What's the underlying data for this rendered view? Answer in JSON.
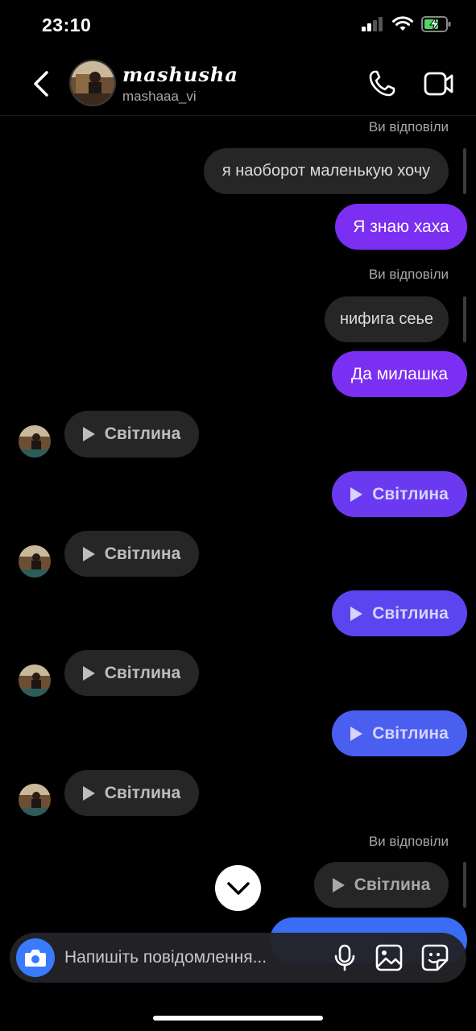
{
  "status": {
    "time": "23:10"
  },
  "header": {
    "title": "mashusha",
    "username": "mashaaa_vi"
  },
  "messages": [
    {
      "reply_label": "Ви відповіли",
      "quoted": "я наоборот маленькую хочу",
      "text": "Я знаю хаха"
    },
    {
      "reply_label": "Ви відповіли",
      "quoted": "нифига сеье",
      "text": "Да милашка"
    },
    {
      "photo_in": "Світлина"
    },
    {
      "photo_out": "Світлина"
    },
    {
      "photo_in": "Світлина"
    },
    {
      "photo_out": "Світлина"
    },
    {
      "photo_in": "Світлина"
    },
    {
      "photo_out": "Світлина"
    },
    {
      "photo_in": "Світлина"
    },
    {
      "reply_label": "Ви відповіли",
      "quoted": "Світлина"
    }
  ],
  "composer": {
    "placeholder": "Напишіть повідомлення..."
  },
  "colors": {
    "purple": "#7b2ff2",
    "blue_purple": "#5a45ee",
    "blue": "#3a7bfd",
    "input_gray": "#262626"
  }
}
